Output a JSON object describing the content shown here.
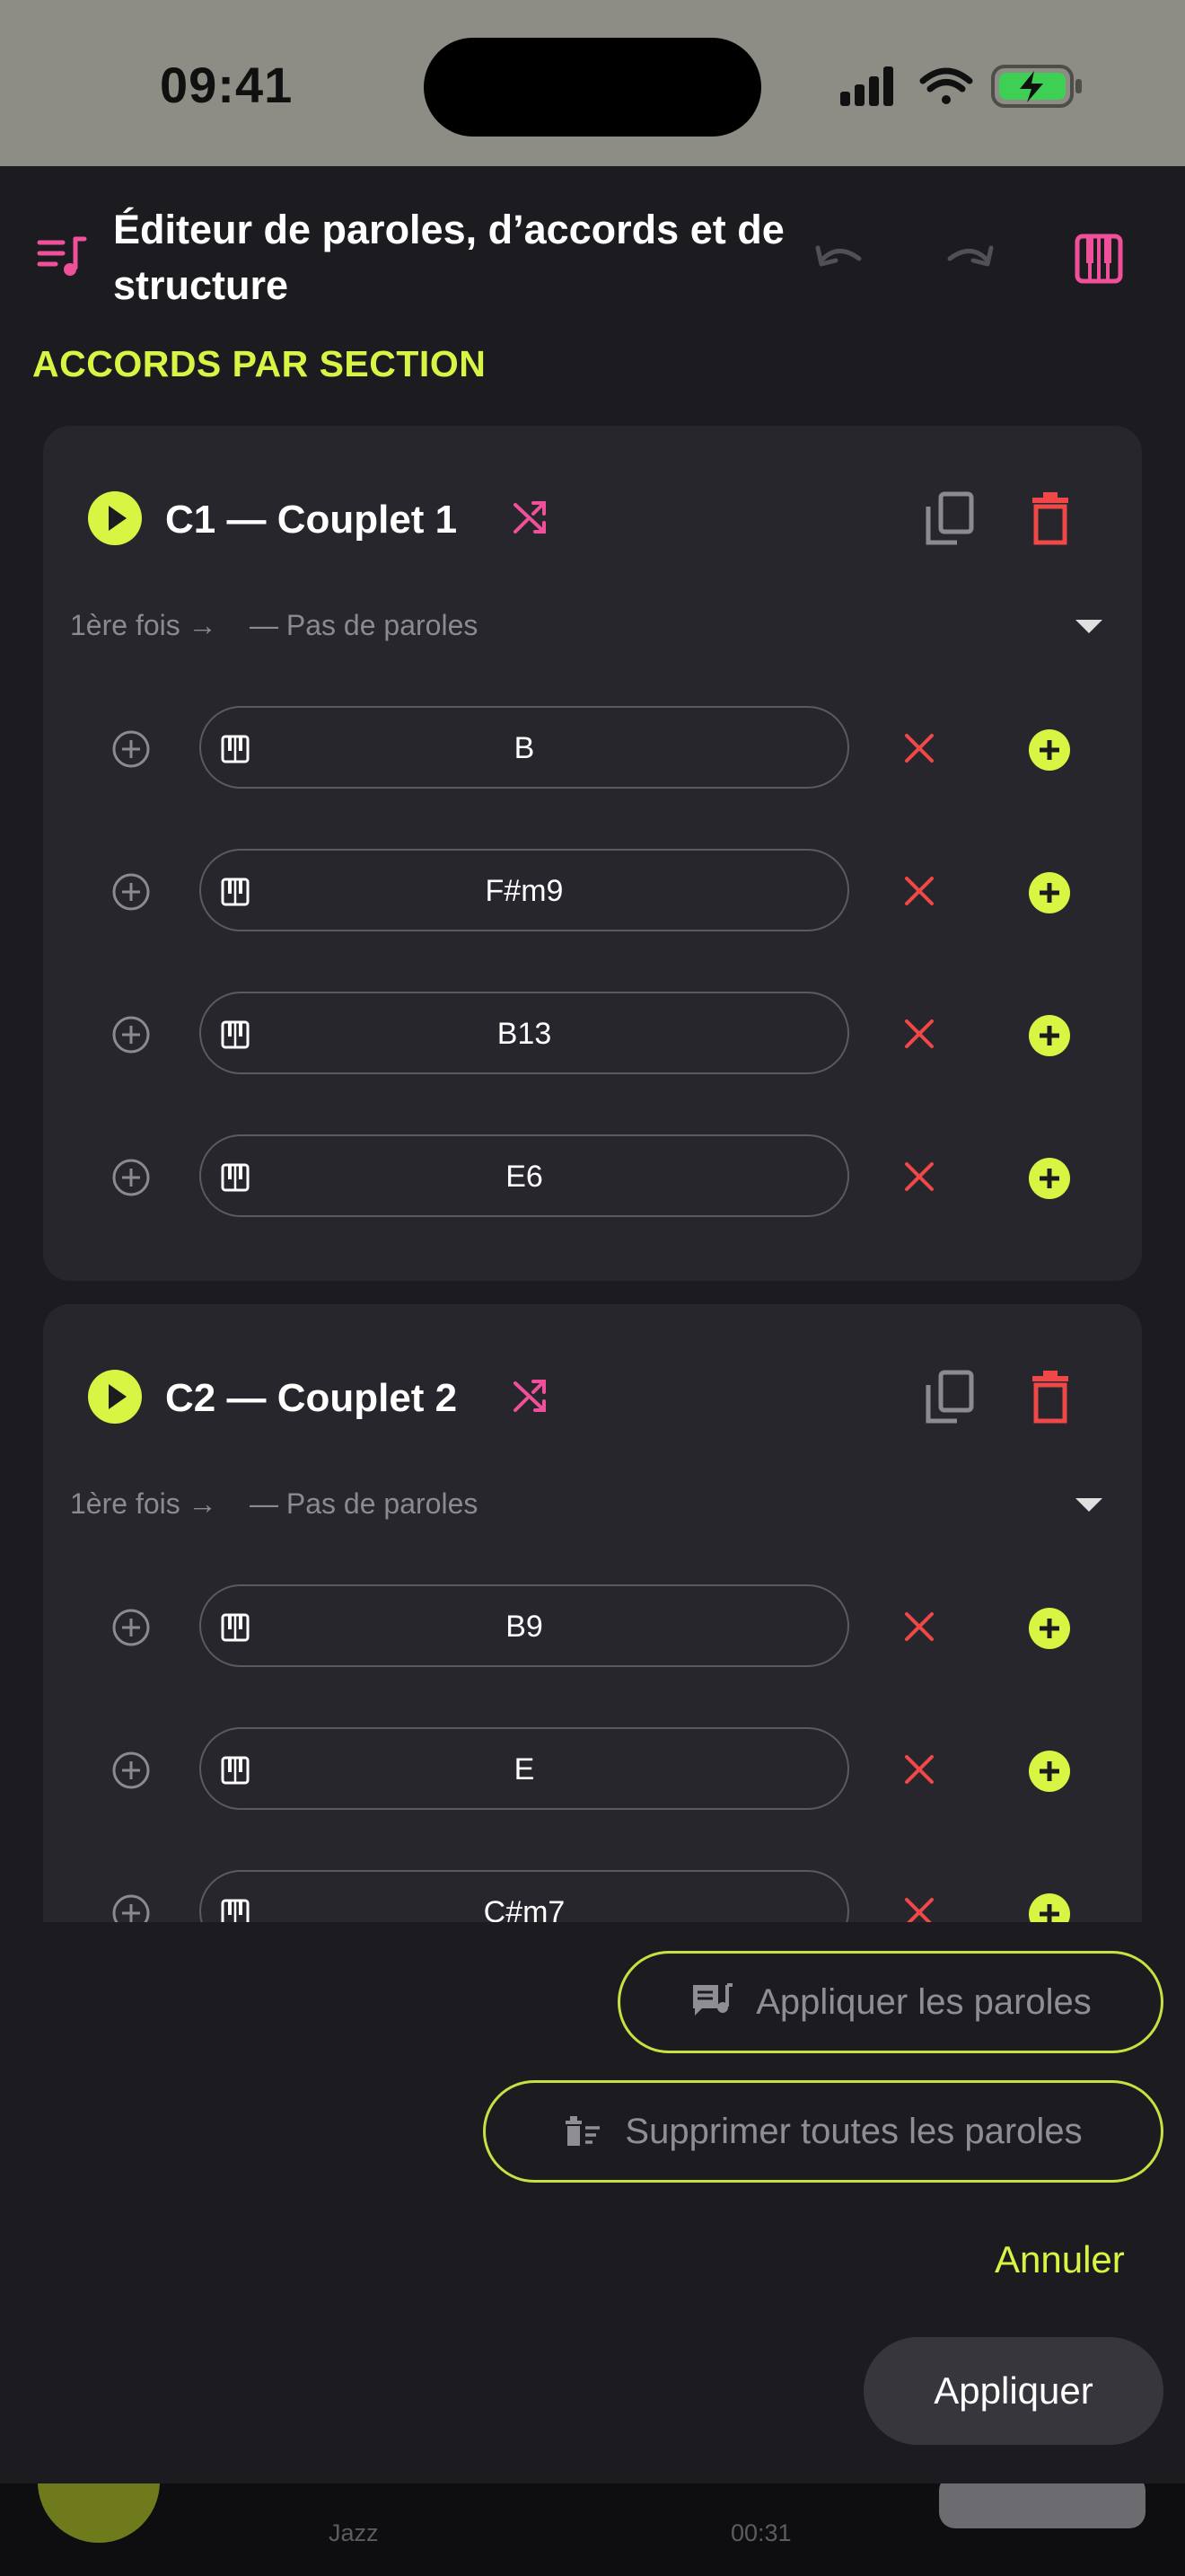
{
  "status_bar": {
    "time": "09:41"
  },
  "header": {
    "title": "Éditeur de paroles, d’accords et de structure",
    "menu_icon": "lyrics-list-icon",
    "undo_icon": "undo-icon",
    "redo_icon": "redo-icon",
    "piano_icon": "piano-icon"
  },
  "section_heading": "ACCORDS PAR SECTION",
  "sections": [
    {
      "title": "C1 — Couplet 1",
      "lyrics_label": "1ère fois →",
      "lyrics_value": "— Pas de paroles",
      "chords": [
        "B",
        "F#m9",
        "B13",
        "E6"
      ]
    },
    {
      "title": "C2 — Couplet 2",
      "lyrics_label": "1ère fois →",
      "lyrics_value": "— Pas de paroles",
      "chords": [
        "B9",
        "E",
        "C#m7"
      ]
    }
  ],
  "actions": {
    "apply_lyrics": "Appliquer les paroles",
    "delete_all_lyrics": "Supprimer toutes les paroles",
    "cancel": "Annuler",
    "apply": "Appliquer"
  },
  "mini_player": {
    "genre": "Jazz",
    "time": "00:31"
  },
  "colors": {
    "accent": "#d7f542",
    "pink": "#f0509a",
    "danger": "#f04848",
    "background": "#1c1c20",
    "card": "#26262c"
  }
}
